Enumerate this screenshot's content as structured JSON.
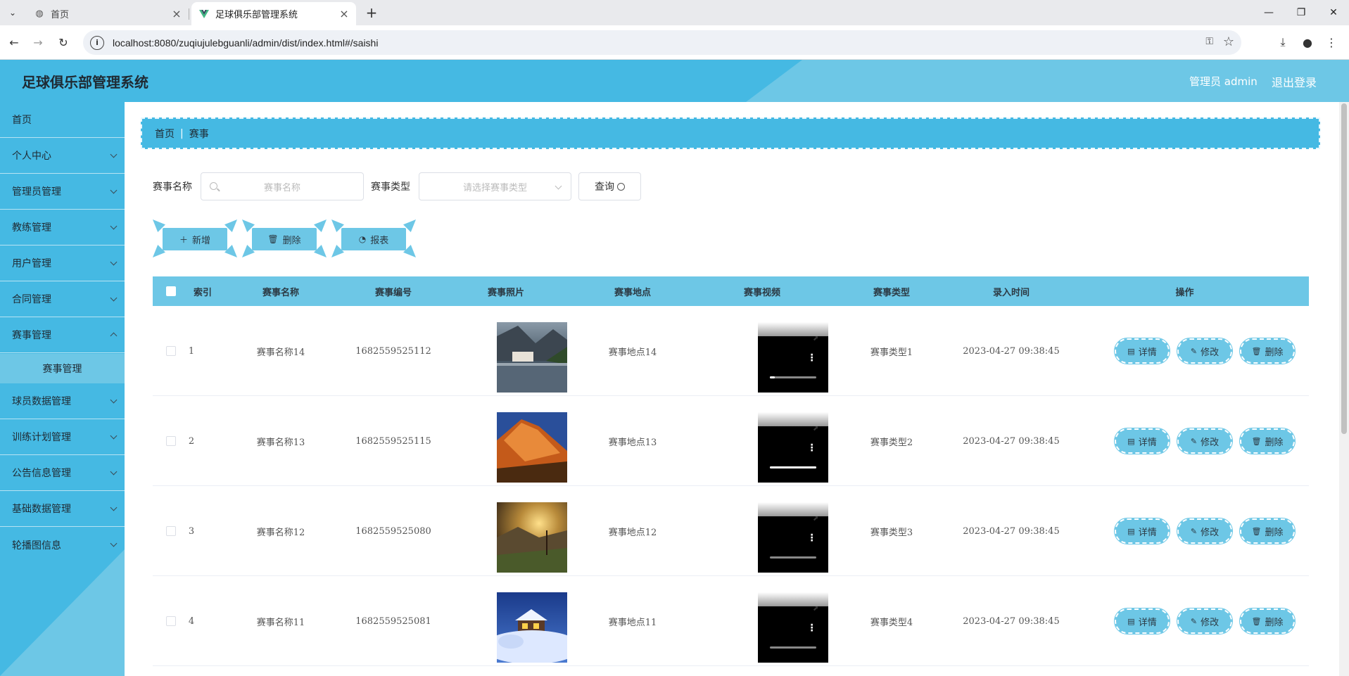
{
  "browser": {
    "tabs": [
      {
        "title": "首页",
        "active": false
      },
      {
        "title": "足球俱乐部管理系统",
        "active": true
      }
    ],
    "url": "localhost:8080/zuqiujulebguanli/admin/dist/index.html#/saishi"
  },
  "header": {
    "title": "足球俱乐部管理系统",
    "user": "管理员 admin",
    "logout": "退出登录"
  },
  "sidebar": {
    "items": [
      {
        "label": "首页"
      },
      {
        "label": "个人中心"
      },
      {
        "label": "管理员管理"
      },
      {
        "label": "教练管理"
      },
      {
        "label": "用户管理"
      },
      {
        "label": "合同管理"
      },
      {
        "label": "赛事管理"
      },
      {
        "label": "球员数据管理"
      },
      {
        "label": "训练计划管理"
      },
      {
        "label": "公告信息管理"
      },
      {
        "label": "基础数据管理"
      },
      {
        "label": "轮播图信息"
      }
    ],
    "sub_item": "赛事管理"
  },
  "breadcrumb": {
    "home": "首页",
    "current": "赛事"
  },
  "search": {
    "name_label": "赛事名称",
    "name_placeholder": "赛事名称",
    "type_label": "赛事类型",
    "type_placeholder": "请选择赛事类型",
    "query": "查询"
  },
  "actions": {
    "add": "新增",
    "delete": "删除",
    "report": "报表"
  },
  "table": {
    "headers": [
      "索引",
      "赛事名称",
      "赛事编号",
      "赛事照片",
      "赛事地点",
      "赛事视频",
      "赛事类型",
      "录入时间",
      "操作"
    ],
    "rows": [
      {
        "index": "1",
        "name": "赛事名称14",
        "code": "1682559525112",
        "location": "赛事地点14",
        "type": "赛事类型1",
        "time": "2023-04-27 09:38:45",
        "video_progress": 0.1
      },
      {
        "index": "2",
        "name": "赛事名称13",
        "code": "1682559525115",
        "location": "赛事地点13",
        "type": "赛事类型2",
        "time": "2023-04-27 09:38:45",
        "video_progress": 1.0
      },
      {
        "index": "3",
        "name": "赛事名称12",
        "code": "1682559525080",
        "location": "赛事地点12",
        "type": "赛事类型3",
        "time": "2023-04-27 09:38:45",
        "video_progress": 0.0
      },
      {
        "index": "4",
        "name": "赛事名称11",
        "code": "1682559525081",
        "location": "赛事地点11",
        "type": "赛事类型4",
        "time": "2023-04-27 09:38:45",
        "video_progress": 0.0
      }
    ],
    "ops": {
      "detail": "详情",
      "edit": "修改",
      "delete": "删除"
    }
  },
  "colors": {
    "primary": "#45b9e3",
    "secondary": "#6dc7e6"
  }
}
